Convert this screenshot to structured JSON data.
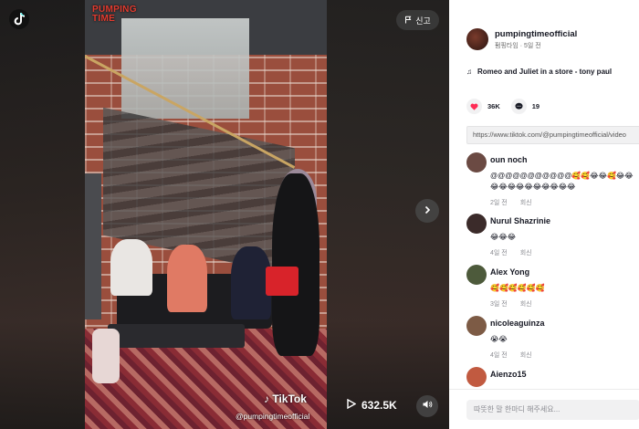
{
  "player": {
    "report_label": "신고",
    "views": "632.5K",
    "watermark_brand": "TikTok",
    "watermark_handle": "@pumpingtimeofficial",
    "overlay_logo": "PUMPING TIME"
  },
  "post": {
    "author": "pumpingtimeofficial",
    "author_sub": "펌핑타임 · 5일 전",
    "music": "Romeo and Juliet in a store - tony paul",
    "likes": "36K",
    "comments_count": "19",
    "link": "https://www.tiktok.com/@pumpingtimeofficial/video"
  },
  "comments": [
    {
      "name": "oun noch",
      "text": "@@@@@@@@@@@🥰🥰😂😂🥰😂😂😂😂😂😂😂😂😂😂😂😂",
      "time": "2일 전",
      "reply": "회신",
      "avatar_color": "#6b4a43"
    },
    {
      "name": "Nurul Shazrinie",
      "text": "😂😂😂",
      "time": "4일 전",
      "reply": "회신",
      "avatar_color": "#3b2b2a"
    },
    {
      "name": "Alex Yong",
      "text": "🥰🥰🥰🥰🥰🥰",
      "time": "3일 전",
      "reply": "회신",
      "avatar_color": "#4d5a3b"
    },
    {
      "name": "nicoleaguinza",
      "text": "😭😭",
      "time": "4일 전",
      "reply": "회신",
      "avatar_color": "#7d5b45"
    },
    {
      "name": "Aienzo15",
      "text": "",
      "time": "",
      "reply": "",
      "avatar_color": "#c15a40"
    }
  ],
  "input": {
    "placeholder": "따뜻한 말 한마디 해주세요..."
  },
  "colors": {
    "like": "#fe2c55",
    "panel_bg": "#ffffff"
  }
}
